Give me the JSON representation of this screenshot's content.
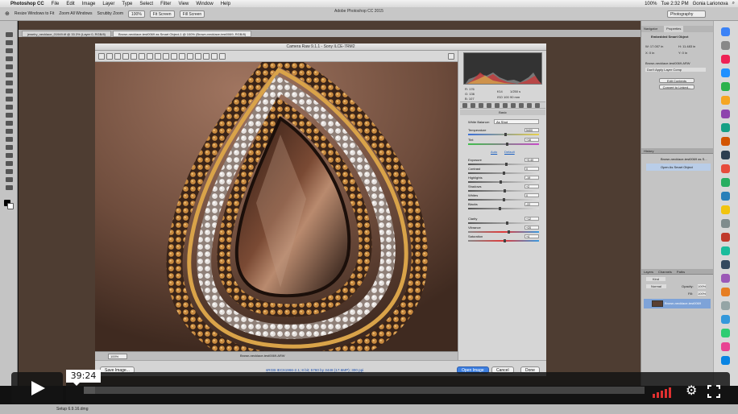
{
  "menubar": {
    "app_name": "Photoshop CC",
    "items": [
      "File",
      "Edit",
      "Image",
      "Layer",
      "Type",
      "Select",
      "Filter",
      "View",
      "Window",
      "Help"
    ],
    "clock": "Tue 2:32 PM",
    "user": "Gonia Larionova",
    "battery": "100%"
  },
  "options_bar": {
    "app_title": "Adobe Photoshop CC 2015",
    "resize_windows": "Resize Windows to Fit",
    "zoom_all": "Zoom All Windows",
    "scrubby_zoom": "Scrubby Zoom",
    "zoom_level": "100%",
    "fit_screen": "Fit Screen",
    "fill_screen": "Fill Screen",
    "workspace": "Photography"
  },
  "document_tabs": [
    "jewelry_necklace_01949.tif @ 33.3% (Layer 0, RGB/8)",
    "Brown-necklace-test0069 as Smart Object-1 @ 100% (Brown-necklace-test0069, RGB/8)"
  ],
  "camera_raw": {
    "title": "Camera Raw 9.1.1 - Sony ILCE-7RM2",
    "zoom": "100%",
    "filename": "Brown-necklace-test0069.ARW",
    "readout": {
      "r": "R: 176",
      "g": "G: 136",
      "b": "B: 107",
      "exposure": "f/14",
      "shutter": "1/250 s",
      "iso": "ISO 100",
      "focal": "90 mm"
    },
    "panel_title": "Basic",
    "white_balance_label": "White Balance:",
    "white_balance_value": "As Shot",
    "auto_label": "Auto",
    "default_label": "Default",
    "sliders": [
      {
        "label": "Temperature",
        "value": "5400",
        "pos": 0.52
      },
      {
        "label": "Tint",
        "value": "+16",
        "pos": 0.55
      },
      {
        "label": "Exposure",
        "value": "+0.40",
        "pos": 0.53
      },
      {
        "label": "Contrast",
        "value": "0",
        "pos": 0.5
      },
      {
        "label": "Highlights",
        "value": "-19",
        "pos": 0.45
      },
      {
        "label": "Shadows",
        "value": "+2",
        "pos": 0.51
      },
      {
        "label": "Whites",
        "value": "0",
        "pos": 0.5
      },
      {
        "label": "Blacks",
        "value": "-22",
        "pos": 0.44
      },
      {
        "label": "Clarity",
        "value": "+12",
        "pos": 0.54
      },
      {
        "label": "Vibrance",
        "value": "+20",
        "pos": 0.57
      },
      {
        "label": "Saturation",
        "value": "+4",
        "pos": 0.51
      }
    ],
    "workflow_link": "sRGB IEC61966-2.1; 8 bit; 5760 by 3448 (17.6MP); 300 ppi",
    "save_button": "Save Image...",
    "open_button": "Open Image",
    "cancel_button": "Cancel",
    "done_button": "Done",
    "colors": {
      "accent": "#3d7fe0",
      "histogram_red": "#c83a3a",
      "histogram_bg": "#333333"
    }
  },
  "properties_panel": {
    "tabs": [
      "Navigator",
      "Properties"
    ],
    "title": "Embedded Smart Object",
    "w_label": "W: 17.007 in",
    "h_label": "H: 11.483 in",
    "x_label": "X: 0 in",
    "y_label": "Y: 0 in",
    "file": "Brown-necklace-test0069.ARW",
    "comps": "Don't Apply Layer Comp",
    "edit_contents": "Edit Contents",
    "convert_linked": "Convert to Linked..."
  },
  "history_panel": {
    "title": "History",
    "items": [
      "Brown-necklace-test0069 as S...",
      "Open As Smart Object"
    ]
  },
  "layers_panel": {
    "tabs": [
      "Layers",
      "Channels",
      "Paths"
    ],
    "kind": "Kind",
    "blend": "Normal",
    "opacity_label": "Opacity:",
    "opacity": "100%",
    "fill_label": "Fill:",
    "fill": "100%",
    "layer_name": "Brown-necklace-test0069"
  },
  "player": {
    "time": "39:24",
    "progress": 0.02
  },
  "status": {
    "text": "Setup 6.9.16.dmg"
  }
}
